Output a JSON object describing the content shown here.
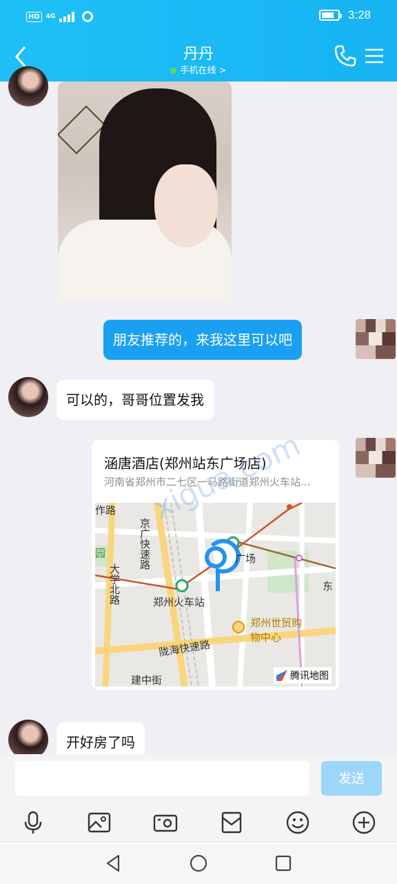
{
  "status_bar": {
    "hd": "HD",
    "network": "4G",
    "time": "3:28",
    "battery_level": 0.75
  },
  "header": {
    "title": "丹丹",
    "subtitle": "手机在线 >",
    "online_color": "#5cdc55"
  },
  "messages": [
    {
      "type": "image",
      "from": "contact"
    },
    {
      "type": "text",
      "from": "me",
      "text": "朋友推荐的，来我这里可以吧"
    },
    {
      "type": "text",
      "from": "contact",
      "text": "可以的，哥哥位置发我"
    },
    {
      "type": "location",
      "from": "me",
      "title": "涵唐酒店(郑州站东广场店)",
      "address": "河南省郑州市二七区一马路街道郑州火车站..."
    },
    {
      "type": "text",
      "from": "contact",
      "text": "开好房了吗"
    }
  ],
  "map_labels": {
    "zhe_lu": "作路",
    "jing_guang": "京广快速路",
    "yuan": "园",
    "daxue_bei_lu": "大学北路",
    "guang_chang": "广场",
    "zhengzhou_station": "郑州火车站",
    "dong": "东",
    "world_trade": "郑州世贸购物中心",
    "longhai": "陇海快速路",
    "jianzhong": "建中街",
    "brand": "腾讯地图"
  },
  "watermark": "xigua.com",
  "input": {
    "placeholder": "",
    "send_label": "发送"
  },
  "toolbar": [
    "mic-icon",
    "image-icon",
    "camera-icon",
    "envelope-icon",
    "emoji-icon",
    "plus-icon"
  ],
  "accent_color": "#1aa0f2"
}
